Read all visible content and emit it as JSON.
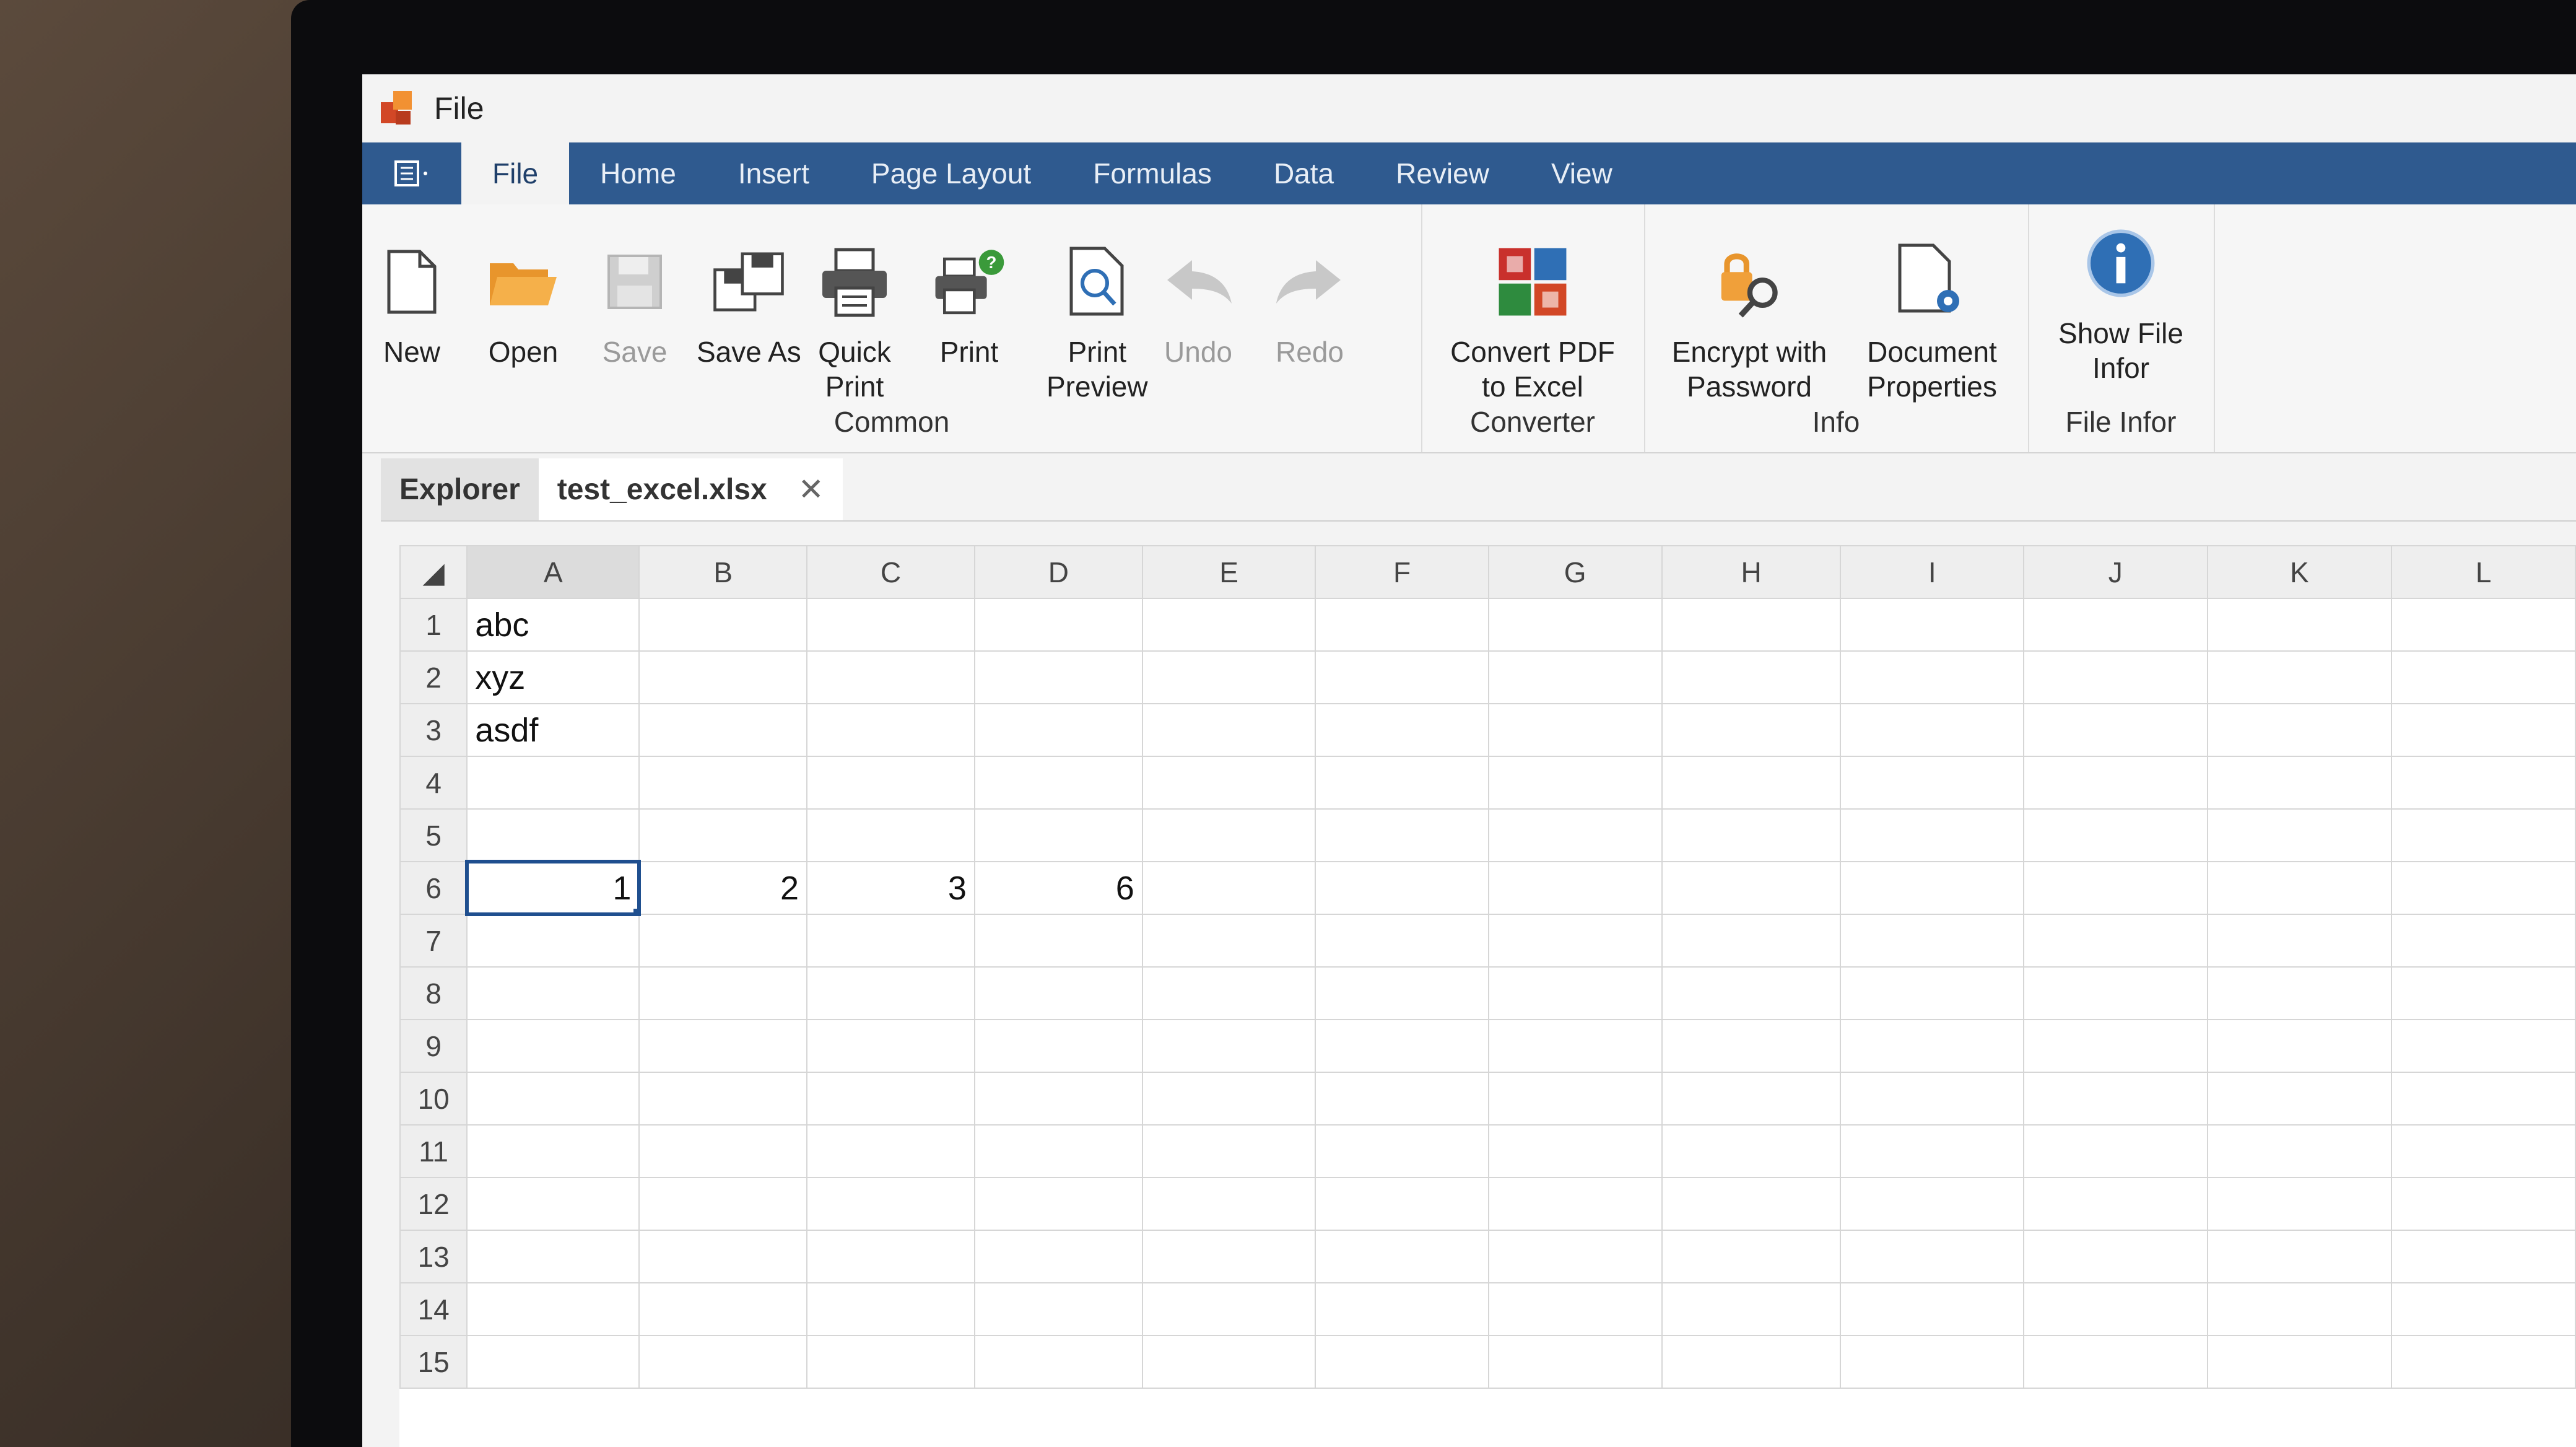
{
  "window": {
    "title": "File"
  },
  "tabs": [
    {
      "label": "File",
      "active": true
    },
    {
      "label": "Home"
    },
    {
      "label": "Insert"
    },
    {
      "label": "Page Layout"
    },
    {
      "label": "Formulas"
    },
    {
      "label": "Data"
    },
    {
      "label": "Review"
    },
    {
      "label": "View"
    }
  ],
  "ribbon": {
    "common": {
      "label": "Common",
      "new": "New",
      "open": "Open",
      "save": "Save",
      "save_as": "Save As",
      "quick_print": "Quick\nPrint",
      "print": "Print",
      "print_preview": "Print\nPreview",
      "undo": "Undo",
      "redo": "Redo"
    },
    "converter": {
      "label": "Converter",
      "convert_pdf": "Convert PDF\nto Excel"
    },
    "info": {
      "label": "Info",
      "encrypt": "Encrypt with\nPassword",
      "doc_props": "Document\nProperties"
    },
    "file_infor": {
      "label": "File Infor",
      "show": "Show File\nInfor"
    }
  },
  "doc_tabs": {
    "explorer": "Explorer",
    "current": "test_excel.xlsx",
    "close_glyph": "✕"
  },
  "sheet": {
    "columns": [
      "A",
      "B",
      "C",
      "D",
      "E",
      "F",
      "G",
      "H",
      "I",
      "J",
      "K",
      "L"
    ],
    "rows": [
      {
        "n": "1",
        "cells": [
          "abc",
          "",
          "",
          "",
          "",
          "",
          "",
          "",
          "",
          "",
          "",
          ""
        ]
      },
      {
        "n": "2",
        "cells": [
          "xyz",
          "",
          "",
          "",
          "",
          "",
          "",
          "",
          "",
          "",
          "",
          ""
        ]
      },
      {
        "n": "3",
        "cells": [
          "asdf",
          "",
          "",
          "",
          "",
          "",
          "",
          "",
          "",
          "",
          "",
          ""
        ]
      },
      {
        "n": "4",
        "cells": [
          "",
          "",
          "",
          "",
          "",
          "",
          "",
          "",
          "",
          "",
          "",
          ""
        ]
      },
      {
        "n": "5",
        "cells": [
          "",
          "",
          "",
          "",
          "",
          "",
          "",
          "",
          "",
          "",
          "",
          ""
        ]
      },
      {
        "n": "6",
        "cells": [
          "1",
          "2",
          "3",
          "6",
          "",
          "",
          "",
          "",
          "",
          "",
          "",
          ""
        ]
      },
      {
        "n": "7",
        "cells": [
          "",
          "",
          "",
          "",
          "",
          "",
          "",
          "",
          "",
          "",
          "",
          ""
        ]
      },
      {
        "n": "8",
        "cells": [
          "",
          "",
          "",
          "",
          "",
          "",
          "",
          "",
          "",
          "",
          "",
          ""
        ]
      },
      {
        "n": "9",
        "cells": [
          "",
          "",
          "",
          "",
          "",
          "",
          "",
          "",
          "",
          "",
          "",
          ""
        ]
      },
      {
        "n": "10",
        "cells": [
          "",
          "",
          "",
          "",
          "",
          "",
          "",
          "",
          "",
          "",
          "",
          ""
        ]
      },
      {
        "n": "11",
        "cells": [
          "",
          "",
          "",
          "",
          "",
          "",
          "",
          "",
          "",
          "",
          "",
          ""
        ]
      },
      {
        "n": "12",
        "cells": [
          "",
          "",
          "",
          "",
          "",
          "",
          "",
          "",
          "",
          "",
          "",
          ""
        ]
      },
      {
        "n": "13",
        "cells": [
          "",
          "",
          "",
          "",
          "",
          "",
          "",
          "",
          "",
          "",
          "",
          ""
        ]
      },
      {
        "n": "14",
        "cells": [
          "",
          "",
          "",
          "",
          "",
          "",
          "",
          "",
          "",
          "",
          "",
          ""
        ]
      },
      {
        "n": "15",
        "cells": [
          "",
          "",
          "",
          "",
          "",
          "",
          "",
          "",
          "",
          "",
          "",
          ""
        ]
      }
    ],
    "selected_cell": "A6",
    "accent": "#1f4f8f"
  },
  "colors": {
    "tab_bar": "#2f5a8f",
    "ribbon": "#f6f6f6"
  }
}
